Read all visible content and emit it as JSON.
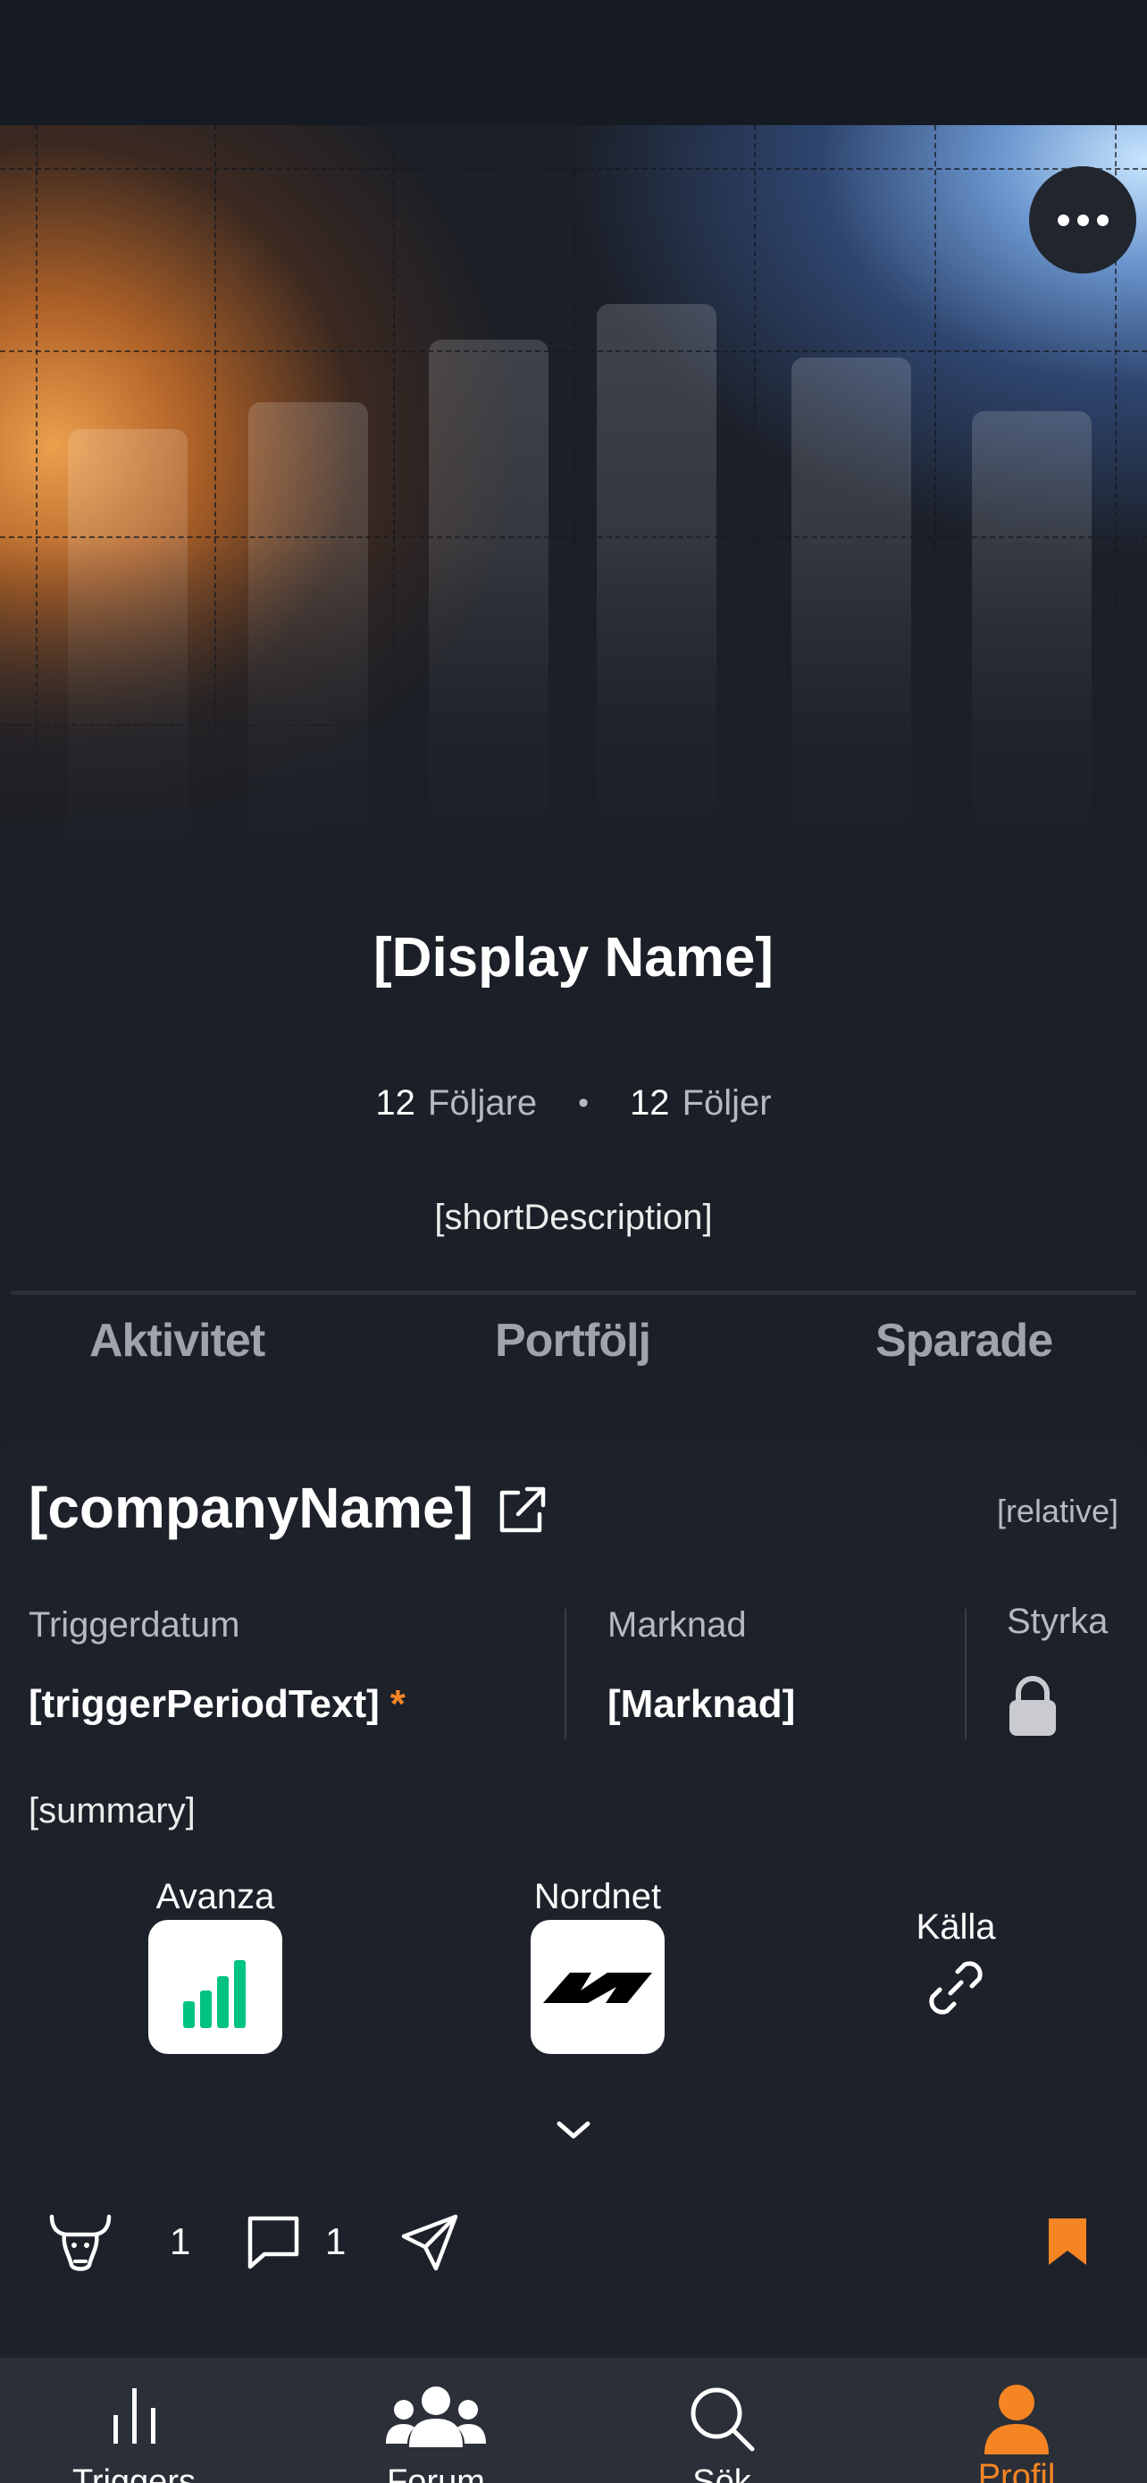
{
  "profile": {
    "display_name": "[Display Name]",
    "followers_count": "12",
    "followers_label": "Följare",
    "following_count": "12",
    "following_label": "Följer",
    "separator": "•",
    "short_description": "[shortDescription]"
  },
  "tabs": [
    {
      "label": "Aktivitet"
    },
    {
      "label": "Portfölj"
    },
    {
      "label": "Sparade"
    }
  ],
  "trigger_card": {
    "company_name": "[companyName]",
    "relative_time": "[relative]",
    "trigger_date_label": "Triggerdatum",
    "trigger_period_text": "[triggerPeriodText]",
    "trigger_asterisk": "*",
    "market_label": "Marknad",
    "market_value": "[Marknad]",
    "strength_label": "Styrka",
    "strength_icon": "lock-icon",
    "summary": "[summary]",
    "sources": [
      {
        "label": "Avanza",
        "icon": "avanza-logo"
      },
      {
        "label": "Nordnet",
        "icon": "nordnet-logo"
      },
      {
        "label": "Källa",
        "icon": "link-icon"
      }
    ],
    "actions": {
      "bull_count": "1",
      "comment_count": "1"
    }
  },
  "bottom_nav": [
    {
      "label": "Triggers",
      "icon": "bar-chart-icon"
    },
    {
      "label": "Forum",
      "icon": "users-icon"
    },
    {
      "label": "Sök",
      "icon": "search-icon"
    },
    {
      "label": "Profil",
      "icon": "user-icon"
    }
  ],
  "colors": {
    "accent": "#f58523",
    "background": "#1b1f27",
    "nav_background": "#2b2f38",
    "avanza_green": "#00c281"
  }
}
